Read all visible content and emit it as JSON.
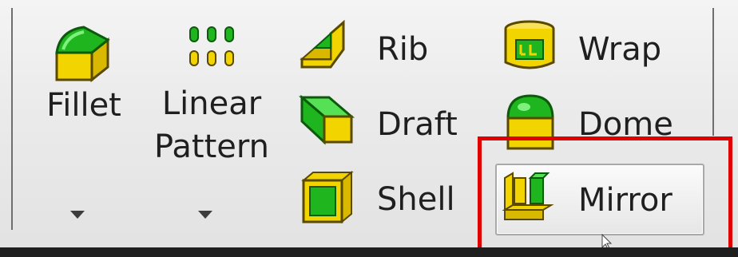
{
  "features": {
    "fillet": {
      "label": "Fillet",
      "icon": "fillet-icon"
    },
    "linear_pattern": {
      "label_line1": "Linear",
      "label_line2": "Pattern",
      "icon": "linear-pattern-icon"
    },
    "rib": {
      "label": "Rib",
      "icon": "rib-icon"
    },
    "draft": {
      "label": "Draft",
      "icon": "draft-icon"
    },
    "shell": {
      "label": "Shell",
      "icon": "shell-icon"
    },
    "wrap": {
      "label": "Wrap",
      "icon": "wrap-icon"
    },
    "dome": {
      "label": "Dome",
      "icon": "dome-icon"
    },
    "mirror": {
      "label": "Mirror",
      "icon": "mirror-icon"
    }
  },
  "colors": {
    "highlight": "#e00000",
    "icon_green": "#1fb51f",
    "icon_yellow": "#f1d400"
  }
}
